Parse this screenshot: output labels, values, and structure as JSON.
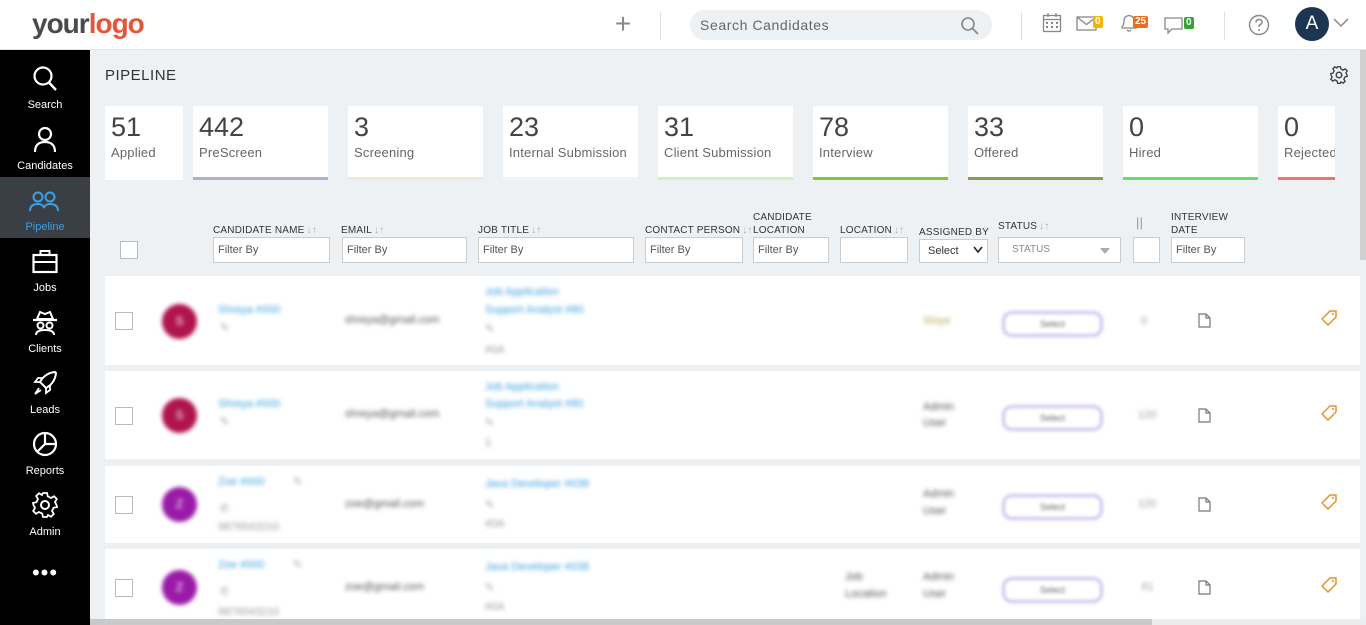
{
  "header": {
    "logo_part1": "your",
    "logo_part2": "logo",
    "search_placeholder": "Search Candidates",
    "mail_badge": "0",
    "bell_badge": "25",
    "chat_badge": "0",
    "avatar_initial": "A",
    "colors": {
      "mail": "#f5b400",
      "bell": "#e96f1c",
      "chat": "#33a532",
      "avatar": "#1d3550"
    }
  },
  "nav": {
    "items": [
      {
        "label": "Search",
        "icon": "search-icon"
      },
      {
        "label": "Candidates",
        "icon": "person-icon"
      },
      {
        "label": "Pipeline",
        "icon": "people-icon",
        "active": true
      },
      {
        "label": "Jobs",
        "icon": "briefcase-icon"
      },
      {
        "label": "Clients",
        "icon": "spy-icon"
      },
      {
        "label": "Leads",
        "icon": "rocket-icon"
      },
      {
        "label": "Reports",
        "icon": "pie-chart-icon"
      },
      {
        "label": "Admin",
        "icon": "gear-icon"
      }
    ],
    "more": "•••"
  },
  "page": {
    "title": "PIPELINE"
  },
  "stages": [
    {
      "count": "51",
      "name": "Applied",
      "color": "#ffffff"
    },
    {
      "count": "442",
      "name": "PreScreen",
      "color": "#b3acd6"
    },
    {
      "count": "3",
      "name": "Screening",
      "color": "#f1ead2"
    },
    {
      "count": "23",
      "name": "Internal Submission",
      "color": "#f3f3f3"
    },
    {
      "count": "31",
      "name": "Client Submission",
      "color": "#c6f5c6"
    },
    {
      "count": "78",
      "name": "Interview",
      "color": "#7fc832"
    },
    {
      "count": "33",
      "name": "Offered",
      "color": "#8c9a55"
    },
    {
      "count": "0",
      "name": "Hired",
      "color": "#62e06a"
    },
    {
      "count": "0",
      "name": "Rejected",
      "color": "#e87474"
    }
  ],
  "table": {
    "columns": {
      "candidate_name": "CANDIDATE NAME",
      "email": "EMAIL",
      "job_title": "JOB TITLE",
      "contact_person": "CONTACT PERSON",
      "candidate_location_1": "CANDIDATE",
      "candidate_location_2": "LOCATION",
      "location": "LOCATION",
      "assigned_by": "ASSIGNED BY",
      "status": "STATUS",
      "pause": "||",
      "interview_date_1": "INTERVIEW",
      "interview_date_2": "DATE"
    },
    "filter_placeholder": "Filter By",
    "assigned_select": "Select",
    "status_select": "STATUS",
    "sort_glyph": "↓↑",
    "rows": [
      {
        "initial": "S",
        "avatar_color": "#b0144d",
        "name": "Shreya #000",
        "email": "shreya@gmail.com",
        "job1": "Job Application",
        "job2": "Support Analyst #80",
        "job_meta": "#0A",
        "assigned1": "Shiye",
        "assigned2": "",
        "status": "Select",
        "count": "0",
        "loc1": "",
        "loc2": "",
        "phone": ""
      },
      {
        "initial": "S",
        "avatar_color": "#b0144d",
        "name": "Shreya #000",
        "email": "shreya@gmail.com",
        "job1": "Job Application",
        "job2": "Support Analyst #80",
        "job_meta": "1",
        "assigned1": "Admin",
        "assigned2": "User",
        "status": "Select",
        "count": "120",
        "loc1": "",
        "loc2": "",
        "phone": ""
      },
      {
        "initial": "Z",
        "avatar_color": "#9a1aa8",
        "name": "Zoe #000",
        "email": "zoe@gmail.com",
        "job1": "Java Developer #038",
        "job2": "",
        "job_meta": "#0A",
        "assigned1": "Admin",
        "assigned2": "User",
        "status": "Select",
        "count": "120",
        "loc1": "",
        "loc2": "",
        "phone": "9876543210"
      },
      {
        "initial": "Z",
        "avatar_color": "#9a1aa8",
        "name": "Zoe #000",
        "email": "zoe@gmail.com",
        "job1": "Java Developer #038",
        "job2": "",
        "job_meta": "#0A",
        "assigned1": "Admin",
        "assigned2": "User",
        "status": "Select",
        "count": "41",
        "loc1": "Job",
        "loc2": "Location",
        "phone": "9876543210"
      }
    ]
  }
}
